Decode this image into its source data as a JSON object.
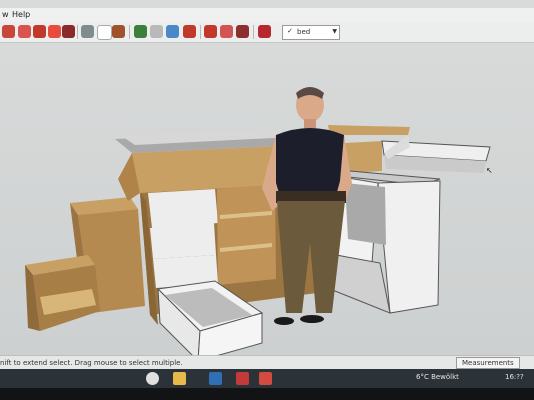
{
  "menubar": {
    "view": "w",
    "help": "Help"
  },
  "toolbar": {
    "layer_value": "bed",
    "layer_check": "✓",
    "icons": [
      "select-icon",
      "eraser-icon",
      "paint-bucket-icon",
      "move-icon",
      "rotate-icon",
      "scale-icon",
      "push-pull-icon",
      "tape-measure-icon",
      "dimension-icon",
      "text-icon",
      "protractor-icon",
      "axes-icon",
      "3d-text-icon",
      "orbit-icon",
      "pan-icon",
      "zoom-icon",
      "zoom-extents-icon",
      "warehouse-icon",
      "extension-icon",
      "extension-manager-icon",
      "ruby-icon"
    ]
  },
  "statusbar": {
    "message": "nift to extend select. Drag mouse to select multiple.",
    "measurements_label": "Measurements"
  },
  "taskbar": {
    "icons": [
      "chrome-icon",
      "file-explorer-icon",
      "store-icon",
      "sketchup-icon",
      "mail-icon"
    ],
    "weather": "6°C  Bewölkt",
    "time": "16:??"
  },
  "scene": {
    "description_colors": {
      "wood": "#c8a064",
      "wood_dark": "#a77e45",
      "panel": "#ececec",
      "panel_shade": "#bdbdbd",
      "shirt": "#1c1f2b",
      "pants": "#6b5a3c"
    }
  }
}
